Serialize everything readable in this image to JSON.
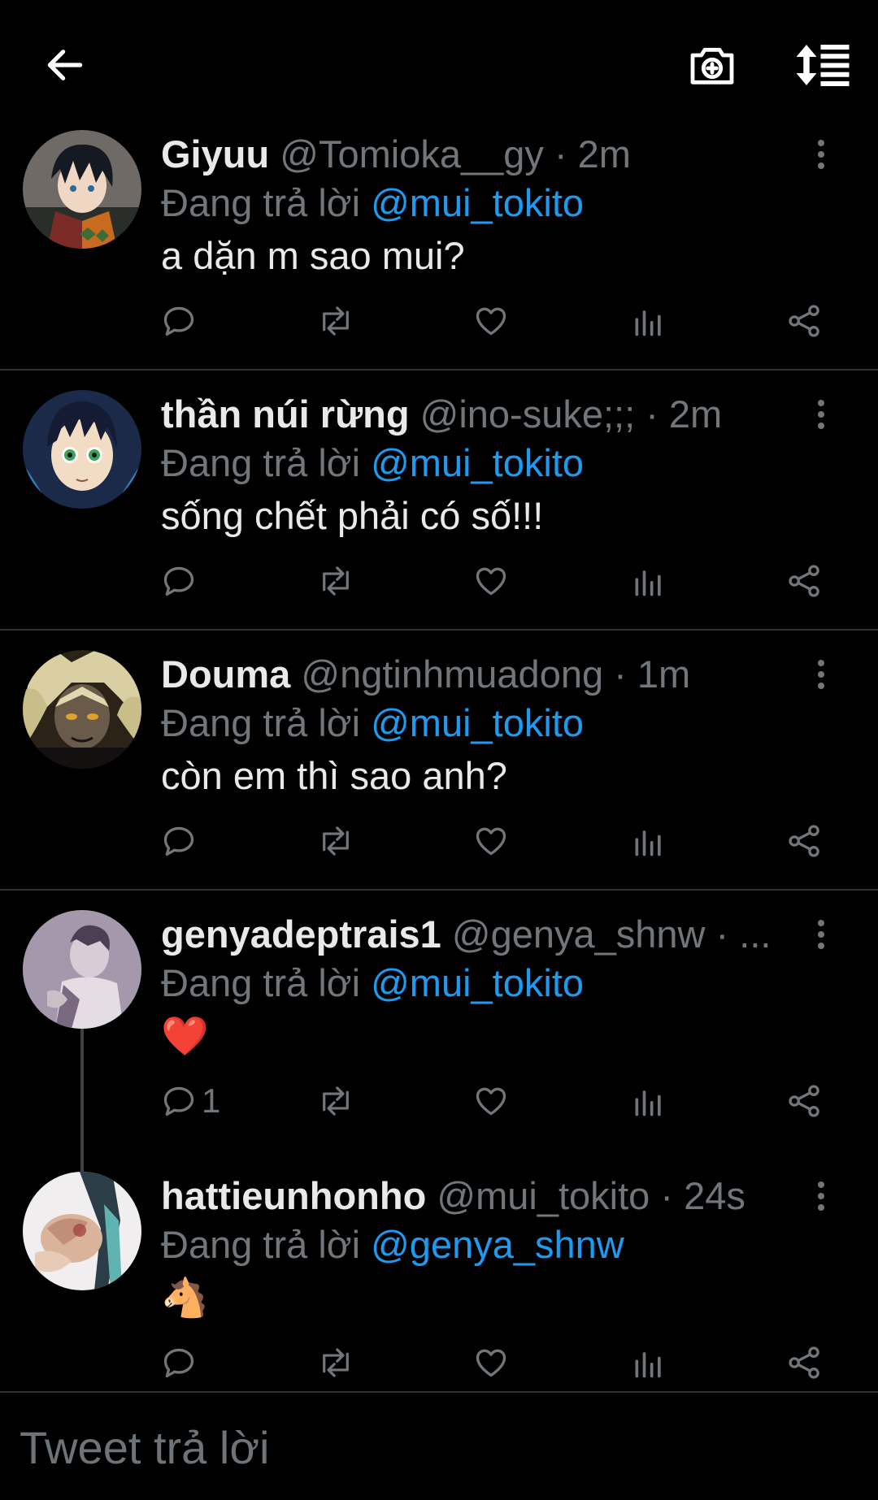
{
  "header": {
    "back_icon": "arrow-left-icon",
    "camera_icon": "camera-plus-icon",
    "sort_icon": "sort-list-icon"
  },
  "replies": [
    {
      "name": "Giyuu",
      "meta": "@Tomioka__gy · 2m",
      "replying_label": "Đang trả lời",
      "replying_to": "@mui_tokito",
      "text": "a dặn m sao mui?",
      "reply_count": ""
    },
    {
      "name": "thần núi rừng",
      "meta": "@ino-suke;;; · 2m",
      "replying_label": "Đang trả lời",
      "replying_to": "@mui_tokito",
      "text": "sống chết phải có số!!!",
      "reply_count": ""
    },
    {
      "name": "Douma",
      "meta": "@ngtinhmuadong · 1m",
      "replying_label": "Đang trả lời",
      "replying_to": "@mui_tokito",
      "text": "còn em thì sao anh?",
      "reply_count": ""
    },
    {
      "name": "genyadeptrais1",
      "meta": "@genya_shnw · ...",
      "replying_label": "Đang trả lời",
      "replying_to": "@mui_tokito",
      "text": "❤️",
      "reply_count": "1"
    },
    {
      "name": "hattieunhonho",
      "meta": "@mui_tokito · 24s",
      "replying_label": "Đang trả lời",
      "replying_to": "@genya_shnw",
      "text": "🐴",
      "reply_count": ""
    }
  ],
  "composer": {
    "placeholder": "Tweet trả lời"
  },
  "colors": {
    "background": "#000000",
    "text": "#e7e9ea",
    "muted": "#71767b",
    "link": "#1d9bf0",
    "divider": "#2f3336"
  }
}
